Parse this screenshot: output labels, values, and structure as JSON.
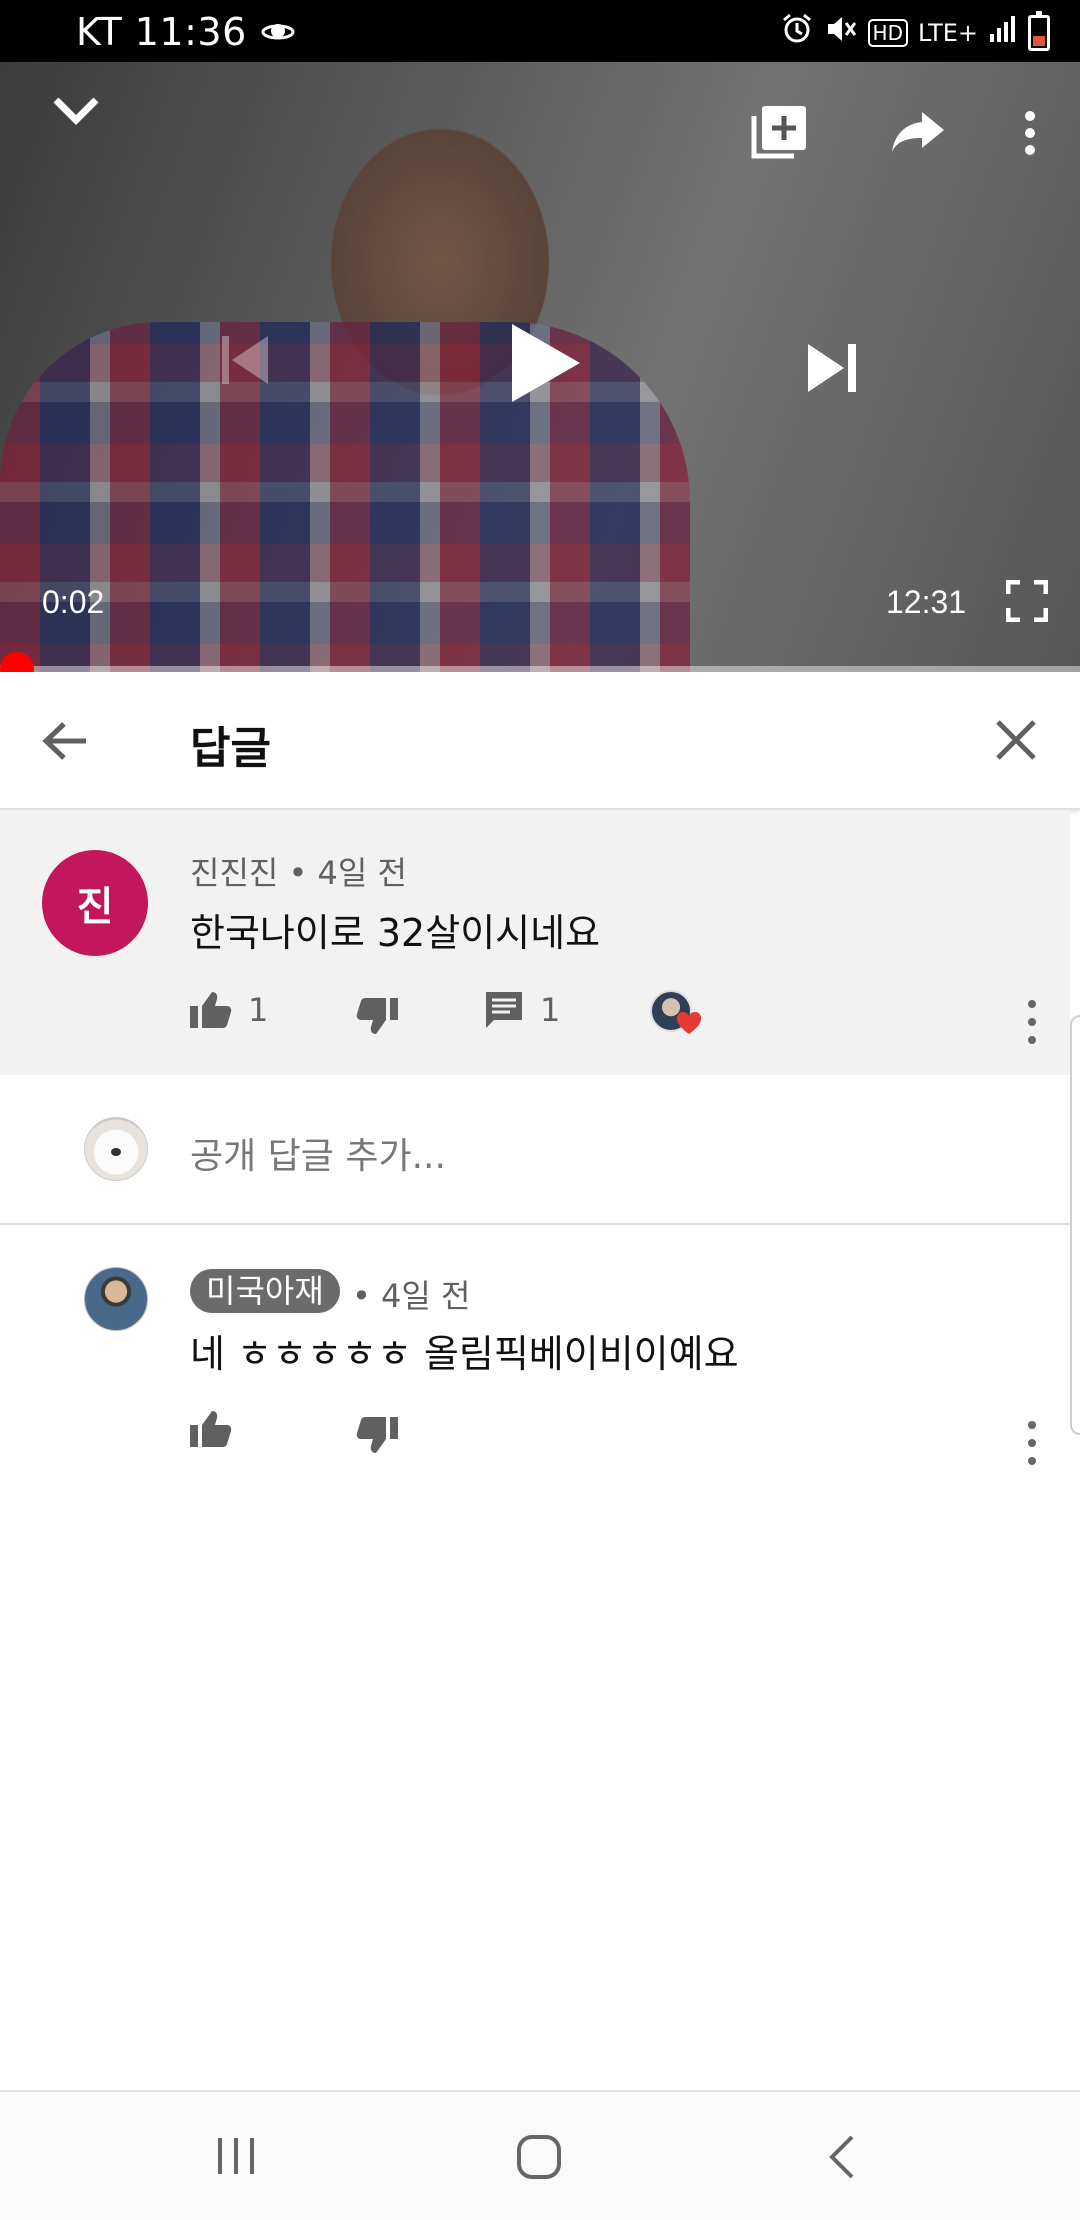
{
  "status_bar": {
    "carrier_time": "KT 11:36",
    "network": "LTE+",
    "hd_label": "HD"
  },
  "player": {
    "current_time": "0:02",
    "duration": "12:31",
    "progress_fraction": 0.003
  },
  "reply_panel": {
    "title": "답글"
  },
  "parent_comment": {
    "avatar_letter": "진",
    "avatar_color": "#c2185b",
    "author": "진진진",
    "age": "4일 전",
    "text": "한국나이로 32살이시네요",
    "likes": "1",
    "replies": "1"
  },
  "add_reply": {
    "placeholder": "공개 답글 추가..."
  },
  "reply_comment": {
    "author": "미국아재",
    "age": "4일 전",
    "text": "네 ㅎㅎㅎㅎㅎ 올림픽베이비이예요"
  },
  "colors": {
    "accent_red": "#ff0000",
    "heart_red": "#e53935"
  }
}
